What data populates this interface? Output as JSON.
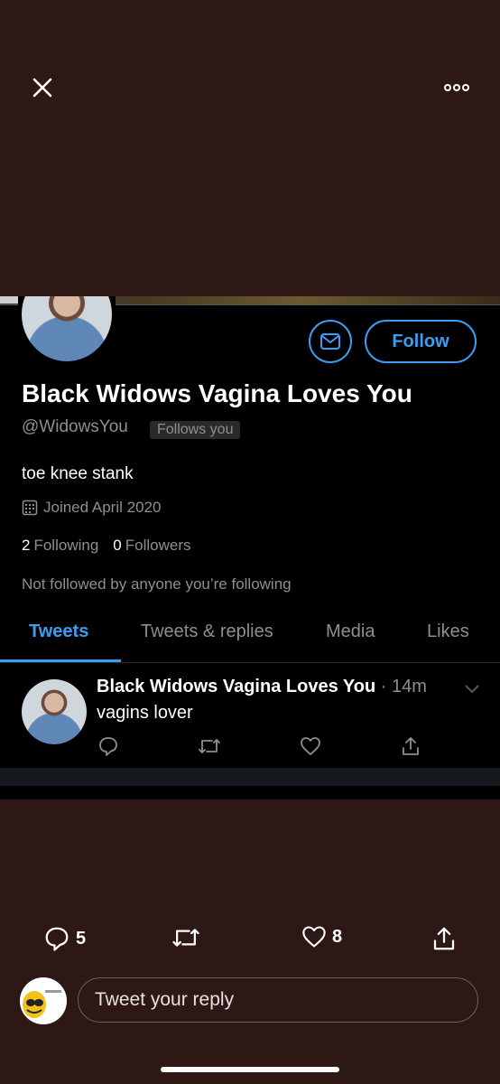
{
  "viewer": {
    "close_icon": "close-icon",
    "more_icon": "more-icon"
  },
  "profile": {
    "display_name": "Black Widows Vagina Loves You",
    "handle": "@WidowsYou",
    "follows_you": "Follows you",
    "bio": "toe knee stank",
    "joined": "Joined April 2020",
    "following_count": "2",
    "following_label": "Following",
    "followers_count": "0",
    "followers_label": "Followers",
    "not_followed": "Not followed by anyone you’re following",
    "follow_label": "Follow"
  },
  "tabs": [
    {
      "label": "Tweets",
      "active": true
    },
    {
      "label": "Tweets & replies",
      "active": false
    },
    {
      "label": "Media",
      "active": false
    },
    {
      "label": "Likes",
      "active": false
    }
  ],
  "tweet": {
    "name": "Black Widows Vagina Loves You",
    "time": " · 14m",
    "text": "vagins lover"
  },
  "bottom_actions": {
    "reply_count": "5",
    "like_count": "8"
  },
  "reply": {
    "placeholder": "Tweet your reply"
  },
  "colors": {
    "background": "#2e1816",
    "accent": "#3c9ef2",
    "muted": "#8e8e93"
  }
}
